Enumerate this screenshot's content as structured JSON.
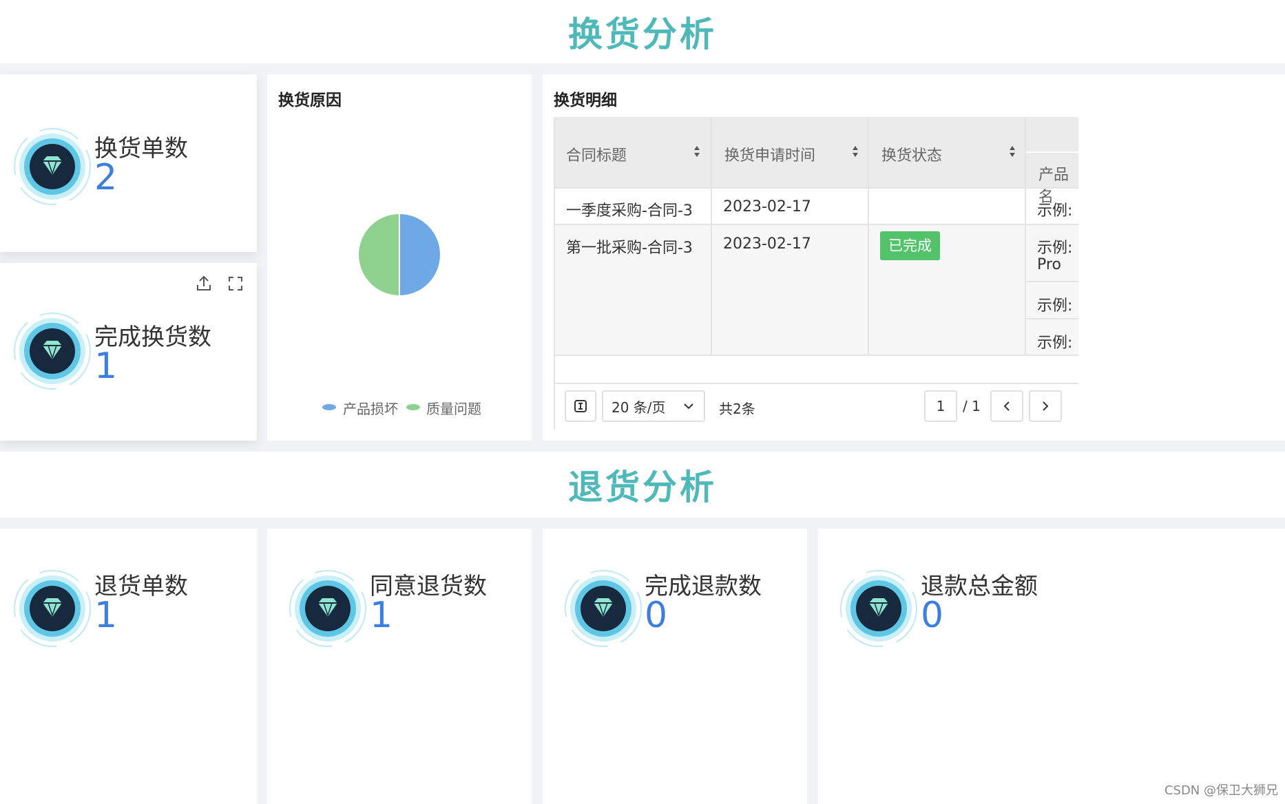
{
  "exchange": {
    "section_title": "换货分析",
    "stat_orders": {
      "label": "换货单数",
      "value": "2"
    },
    "stat_done": {
      "label": "完成换货数",
      "value": "1"
    },
    "reason_panel": {
      "title": "换货原因",
      "legend": [
        "产品损坏",
        "质量问题"
      ]
    },
    "detail_panel": {
      "title": "换货明细",
      "columns": [
        "合同标题",
        "换货申请时间",
        "换货状态",
        "产品名"
      ],
      "rows": [
        {
          "title": "一季度采购-合同-3",
          "time": "2023-02-17",
          "status": "",
          "product": [
            "示例:"
          ]
        },
        {
          "title": "第一批采购-合同-3",
          "time": "2023-02-17",
          "status": "已完成",
          "product": [
            "示例:",
            "Pro",
            "示例:",
            "示例:"
          ]
        }
      ],
      "pager": {
        "page_size": "20 条/页",
        "total": "共2条",
        "current": "1",
        "pages": "/ 1"
      }
    }
  },
  "returns": {
    "section_title": "退货分析",
    "stats": [
      {
        "label": "退货单数",
        "value": "1"
      },
      {
        "label": "同意退货数",
        "value": "1"
      },
      {
        "label": "完成退款数",
        "value": "0"
      },
      {
        "label": "退款总金额",
        "value": "0"
      }
    ]
  },
  "chart_data": {
    "type": "pie",
    "categories": [
      "产品损坏",
      "质量问题"
    ],
    "values": [
      1,
      1
    ],
    "colors": [
      "#6ea9e6",
      "#8fd28f"
    ],
    "title": "换货原因",
    "legend": "bottom"
  },
  "watermark": "CSDN @保卫大狮兄",
  "colors": {
    "accent": "#4fb8b8",
    "value_blue": "#3d7fe0",
    "success": "#52c369"
  }
}
